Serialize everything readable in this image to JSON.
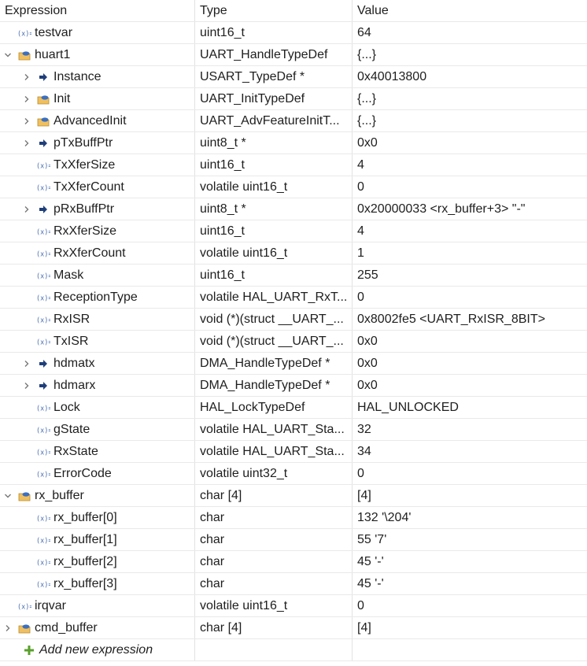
{
  "headers": {
    "expression": "Expression",
    "type": "Type",
    "value": "Value"
  },
  "rows": [
    {
      "name": "testvar",
      "type": "uint16_t",
      "value": "64",
      "level": 0,
      "twisty": "none",
      "icon": "variable"
    },
    {
      "name": "huart1",
      "type": "UART_HandleTypeDef",
      "value": "{...}",
      "level": 0,
      "twisty": "expanded",
      "icon": "struct"
    },
    {
      "name": "Instance",
      "type": "USART_TypeDef *",
      "value": "0x40013800",
      "level": 1,
      "twisty": "collapsed",
      "icon": "pointer"
    },
    {
      "name": "Init",
      "type": "UART_InitTypeDef",
      "value": "{...}",
      "level": 1,
      "twisty": "collapsed",
      "icon": "struct"
    },
    {
      "name": "AdvancedInit",
      "type": "UART_AdvFeatureInitT...",
      "value": "{...}",
      "level": 1,
      "twisty": "collapsed",
      "icon": "struct"
    },
    {
      "name": "pTxBuffPtr",
      "type": "uint8_t *",
      "value": "0x0",
      "level": 1,
      "twisty": "collapsed",
      "icon": "pointer"
    },
    {
      "name": "TxXferSize",
      "type": "uint16_t",
      "value": "4",
      "level": 1,
      "twisty": "none",
      "icon": "variable"
    },
    {
      "name": "TxXferCount",
      "type": "volatile uint16_t",
      "value": "0",
      "level": 1,
      "twisty": "none",
      "icon": "variable"
    },
    {
      "name": "pRxBuffPtr",
      "type": "uint8_t *",
      "value": "0x20000033 <rx_buffer+3> \"-\"",
      "level": 1,
      "twisty": "collapsed",
      "icon": "pointer"
    },
    {
      "name": "RxXferSize",
      "type": "uint16_t",
      "value": "4",
      "level": 1,
      "twisty": "none",
      "icon": "variable"
    },
    {
      "name": "RxXferCount",
      "type": "volatile uint16_t",
      "value": "1",
      "level": 1,
      "twisty": "none",
      "icon": "variable"
    },
    {
      "name": "Mask",
      "type": "uint16_t",
      "value": "255",
      "level": 1,
      "twisty": "none",
      "icon": "variable"
    },
    {
      "name": "ReceptionType",
      "type": "volatile HAL_UART_RxT...",
      "value": "0",
      "level": 1,
      "twisty": "none",
      "icon": "variable"
    },
    {
      "name": "RxISR",
      "type": "void (*)(struct __UART_...",
      "value": "0x8002fe5 <UART_RxISR_8BIT>",
      "level": 1,
      "twisty": "none",
      "icon": "variable"
    },
    {
      "name": "TxISR",
      "type": "void (*)(struct __UART_...",
      "value": "0x0",
      "level": 1,
      "twisty": "none",
      "icon": "variable"
    },
    {
      "name": "hdmatx",
      "type": "DMA_HandleTypeDef *",
      "value": "0x0",
      "level": 1,
      "twisty": "collapsed",
      "icon": "pointer"
    },
    {
      "name": "hdmarx",
      "type": "DMA_HandleTypeDef *",
      "value": "0x0",
      "level": 1,
      "twisty": "collapsed",
      "icon": "pointer"
    },
    {
      "name": "Lock",
      "type": "HAL_LockTypeDef",
      "value": "HAL_UNLOCKED",
      "level": 1,
      "twisty": "none",
      "icon": "variable"
    },
    {
      "name": "gState",
      "type": "volatile HAL_UART_Sta...",
      "value": "32",
      "level": 1,
      "twisty": "none",
      "icon": "variable"
    },
    {
      "name": "RxState",
      "type": "volatile HAL_UART_Sta...",
      "value": "34",
      "level": 1,
      "twisty": "none",
      "icon": "variable"
    },
    {
      "name": "ErrorCode",
      "type": "volatile uint32_t",
      "value": "0",
      "level": 1,
      "twisty": "none",
      "icon": "variable"
    },
    {
      "name": "rx_buffer",
      "type": "char [4]",
      "value": "[4]",
      "level": 0,
      "twisty": "expanded",
      "icon": "struct"
    },
    {
      "name": "rx_buffer[0]",
      "type": "char",
      "value": "132 '\\204'",
      "level": 1,
      "twisty": "none",
      "icon": "variable"
    },
    {
      "name": "rx_buffer[1]",
      "type": "char",
      "value": "55 '7'",
      "level": 1,
      "twisty": "none",
      "icon": "variable"
    },
    {
      "name": "rx_buffer[2]",
      "type": "char",
      "value": "45 '-'",
      "level": 1,
      "twisty": "none",
      "icon": "variable"
    },
    {
      "name": "rx_buffer[3]",
      "type": "char",
      "value": "45 '-'",
      "level": 1,
      "twisty": "none",
      "icon": "variable"
    },
    {
      "name": "irqvar",
      "type": "volatile uint16_t",
      "value": "0",
      "level": 0,
      "twisty": "none",
      "icon": "variable"
    },
    {
      "name": "cmd_buffer",
      "type": "char [4]",
      "value": "[4]",
      "level": 0,
      "twisty": "collapsed",
      "icon": "struct"
    }
  ],
  "add_row": {
    "label": "Add new expression",
    "icon": "plus-icon"
  },
  "colors": {
    "grid_line": "#e9e9e9",
    "column_divider": "#e2e2e2",
    "twisty": "#777777",
    "variable_icon": "#4a6fb0",
    "pointer_icon": "#1f3f7a",
    "struct_icon_body": "#f0c060",
    "struct_icon_top": "#3c6fbf",
    "plus_icon": "#5aa02c"
  }
}
